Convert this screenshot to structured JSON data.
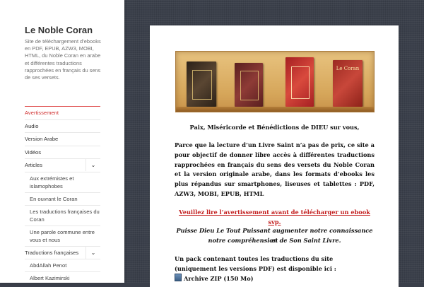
{
  "site": {
    "title": "Le Noble Coran",
    "description": "Site de téléchargement d’ebooks en PDF, EPUB, AZW3, MOBI, HTML, du Noble Coran en arabe et différentes traductions rapprochées en français du sens de ses versets."
  },
  "nav": {
    "items": [
      {
        "label": "Avertissement",
        "active": true
      },
      {
        "label": "Audio"
      },
      {
        "label": "Version Arabe"
      },
      {
        "label": "Vidéos"
      },
      {
        "label": "Articles",
        "toggle": "chevron-down"
      }
    ],
    "articles_sub": [
      "Aux extrémistes et islamophobes",
      "En ouvrant le Coran",
      "Les traductions françaises du Coran",
      "Une parole commune entre vous et nous"
    ],
    "translations": {
      "label": "Traductions françaises",
      "toggle": "chevron-down"
    },
    "translations_sub": [
      "AbdAllah Penot",
      "Albert Kazimirski"
    ]
  },
  "content": {
    "greeting": "Paix, Miséricorde et Bénédictions de DIEU sur vous,",
    "intro": "Parce que la lecture d’un Livre Saint n’a pas de prix, ce site a pour objectif de donner libre accès à différentes traductions rapprochées en français du sens des versets du Noble Coran et la version originale arabe, dans les formats d’ebooks les plus répandus sur smartphones, liseuses et tablettes : PDF, AZW3, MOBI, EPUB, HTML",
    "warning_link": "Veuillez lire l’avertissement avant de télécharger un ebook svp.",
    "prayer_line1": "Puisse Dieu Le Tout Puissant augmenter notre connaissance et",
    "prayer_line2": "notre compréhension de Son Saint Livre.",
    "pack_text": "Un pack contenant toutes les traductions du site (uniquement les versions PDF) est disponible ici :",
    "archive_link": "Archive ZIP (150 Mo)",
    "book_label": "Le Coran"
  },
  "colors": {
    "accent": "#d03030",
    "link": "#c21d1d",
    "background": "#3b404b"
  }
}
